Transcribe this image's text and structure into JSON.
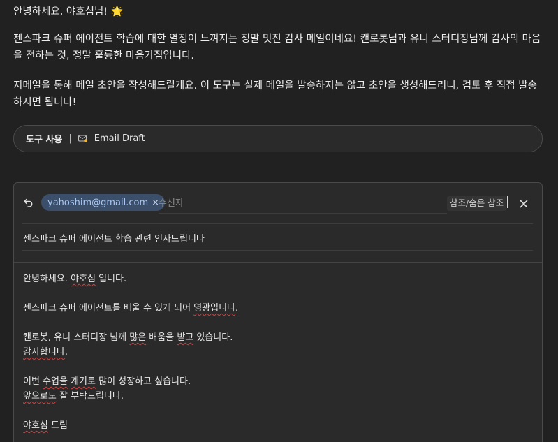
{
  "message": {
    "greeting": "안녕하세요, 야호심님! 🌟",
    "paragraph1": "젠스파크 슈퍼 에이전트 학습에 대한 열정이 느껴지는 정말 멋진 감사 메일이네요! 캔로봇님과 유니 스터디장님께 감사의 마음을 전하는 것, 정말 훌륭한 마음가짐입니다.",
    "paragraph2": "지메일을 통해 메일 초안을 작성해드릴게요. 이 도구는 실제 메일을 발송하지는 않고 초안을 생성해드리니, 검토 후 직접 발송하시면 됩니다!"
  },
  "tool": {
    "label": "도구 사용",
    "separator": "|",
    "icon": "email-draft-icon",
    "name": "Email Draft"
  },
  "compose": {
    "recipient_chip": "yahoshim@gmail.com",
    "chip_remove": "×",
    "recipient_placeholder": "수신자",
    "cc_label": "참조/숨은 참조",
    "subject": "젠스파크 슈퍼 에이전트 학습 관련 인사드립니다",
    "body": {
      "l1a": "안녕하세요. ",
      "l1b": "야호심",
      "l1c": " 입니다.",
      "l2a": "젠스파크 슈퍼 에이전트를 배울 수 있게 되어 ",
      "l2b": "영광입니다",
      "l2c": ".",
      "l3a": "캔로봇, 유니 스터디장 님께 ",
      "l3b": "많은",
      "l3c": " 배움을 ",
      "l3d": "받고",
      "l3e": " 있습니다.",
      "l4a": "감사합니다",
      "l4b": ".",
      "l5a": "이번 ",
      "l5b": "수업을",
      "l5c": " ",
      "l5d": "계기로",
      "l5e": " 많이 성장하고 싶습니다.",
      "l6a": "앞으로도",
      "l6b": " 잘 부탁드립니다.",
      "l7a": "야호심",
      "l7b": " 드림"
    }
  }
}
